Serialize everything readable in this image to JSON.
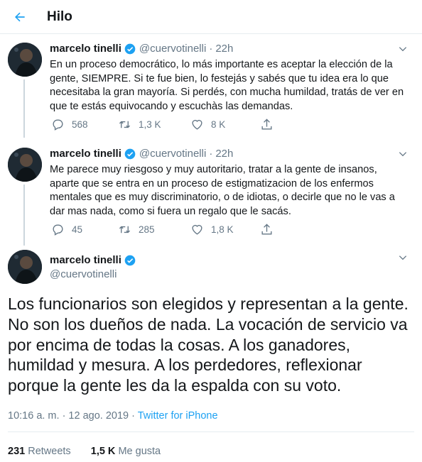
{
  "header": {
    "title": "Hilo"
  },
  "colors": {
    "accent": "#1da1f2",
    "text": "#14171a",
    "muted": "#657786",
    "border": "#e6ecf0"
  },
  "tweets": [
    {
      "name": "marcelo tinelli",
      "handle": "@cuervotinelli",
      "separator": "·",
      "time": "22h",
      "text": "En un proceso democrático, lo más importante es aceptar la elección de la gente, SIEMPRE. Si te fue bien, lo festejás y sabés que tu idea era lo que necesitaba la gran mayoría. Si perdés, con mucha humildad, tratás de ver en que te estás equivocando y escuchàs las demandas.",
      "replies": "568",
      "retweets": "1,3 K",
      "likes": "8 K"
    },
    {
      "name": "marcelo tinelli",
      "handle": "@cuervotinelli",
      "separator": "·",
      "time": "22h",
      "text": "Me parece muy riesgoso y muy autoritario, tratar a la gente de insanos, aparte que se entra en un proceso de estigmatizacion de los enfermos mentales que es muy discriminatorio, o de idiotas, o decirle que no le vas a dar mas nada, como si fuera un regalo que le sacás.",
      "replies": "45",
      "retweets": "285",
      "likes": "1,8 K"
    }
  ],
  "main_tweet": {
    "name": "marcelo tinelli",
    "handle": "@cuervotinelli",
    "text": "Los funcionarios son elegidos y representan a la gente. No son los dueños de nada. La vocación de servicio va por encima de todas la cosas. A los ganadores, humildad y mesura. A los perdedores, reflexionar porque la gente les da la espalda con su voto.",
    "timestamp": "10:16 a. m. · 12 ago. 2019 · ",
    "source": "Twitter for iPhone",
    "retweet_count": "231",
    "retweet_label": "Retweets",
    "like_count": "1,5 K",
    "like_label": "Me gusta"
  },
  "icons": [
    "back-arrow-icon",
    "verified-badge-icon",
    "chevron-down-icon",
    "reply-icon",
    "retweet-icon",
    "like-icon",
    "share-icon"
  ]
}
